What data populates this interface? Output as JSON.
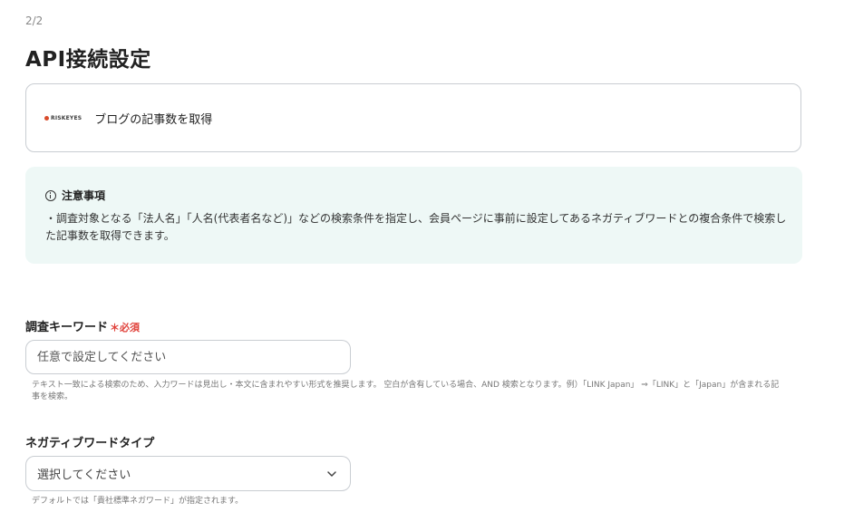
{
  "header": {
    "step": "2/2",
    "title": "API接続設定"
  },
  "app_card": {
    "logo_text": "RISKEYES",
    "action_label": "ブログの記事数を取得"
  },
  "notice": {
    "heading": "注意事項",
    "body": "・調査対象となる「法人名」「人名(代表者名など)」などの検索条件を指定し、会員ページに事前に設定してあるネガティブワードとの複合条件で検索した記事数を取得できます。"
  },
  "fields": {
    "keyword": {
      "label": "調査キーワード",
      "required_mark": "＊必須",
      "placeholder": "任意で設定してください",
      "help": "テキスト一致による検索のため、入力ワードは見出し・本文に含まれやすい形式を推奨します。 空白が含有している場合、AND 検索となります。例）「LINK Japan」 ⇒「LINK」と「Japan」が含まれる記事を検索。"
    },
    "negative_type": {
      "label": "ネガティブワードタイプ",
      "selected": "選択してください",
      "help": "デフォルトでは「貴社標準ネガワード」が指定されます。"
    }
  },
  "icons": {
    "info": "info-circle-icon",
    "dropdown": "chevron-down-icon"
  },
  "colors": {
    "required": "#e0413a",
    "notice_bg": "#eef8f6",
    "border": "#c9cdd2"
  }
}
